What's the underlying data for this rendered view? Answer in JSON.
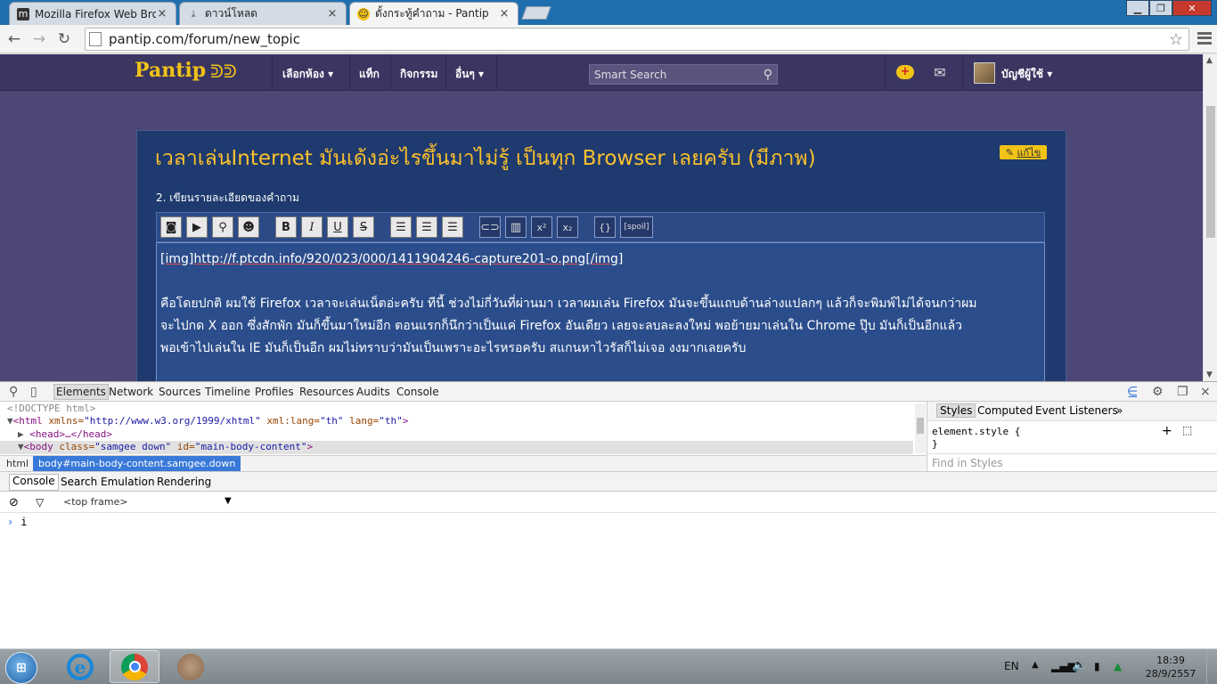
{
  "browser": {
    "tabs": [
      {
        "title": "Mozilla Firefox Web Brows",
        "active": false,
        "icon": "m-logo-icon"
      },
      {
        "title": "ดาวน์โหลด",
        "active": false,
        "icon": "download-icon"
      },
      {
        "title": "ตั้งกระทู้คำถาม - Pantip",
        "active": true,
        "icon": "pantip-smiley-icon"
      }
    ],
    "url": "pantip.com/forum/new_topic"
  },
  "site": {
    "logo": "Pantip",
    "nav": [
      "เลือกห้อง ▾",
      "แท็ก",
      "กิจกรรม",
      "อื่นๆ ▾"
    ],
    "search_placeholder": "Smart Search",
    "user": "บัญชีผู้ใช้ ▾"
  },
  "post": {
    "title": "เวลาเล่นInternet มันเด้งอ่ะไรขึ้นมาไม่รู้ เป็นทุก Browser เลยครับ (มีภาพ)",
    "edit_label": "แก้ไข",
    "section_label": "2. เขียนรายละเอียดของคำถาม",
    "body_lines": [
      "[img]http://f.ptcdn.info/920/023/000/1411904246-capture201-o.png[/img]",
      "",
      "คือโดยปกติ ผมใช้ Firefox เวลาจะเล่นเน็ตอ่ะครับ ทีนี้ ช่วงไม่กี่วันที่ผ่านมา เวลาผมเล่น Firefox มันจะขึ้นแถบด้านล่างแปลกๆ แล้วก็จะพิมพ์ไม่ได้จนกว่าผม",
      "จะไปกด X ออก ซึ่งสักพัก มันก็ขึ้นมาใหม่อีก ตอนแรกก็นึกว่าเป็นแค่ Firefox อันเดียว เลยจะลบละลงใหม่ พอย้ายมาเล่นใน Chrome ปุ๊บ มันก็เป็นอีกแล้ว",
      "พอเข้าไปเล่นใน IE มันก็เป็นอีก ผมไม่ทราบว่ามันเป็นเพราะอะไรหรอครับ สแกนหาไวรัสก็ไม่เจอ งงมากเลยครับ"
    ],
    "toolbar_buttons": [
      "camera-icon",
      "video-icon",
      "map-pin-icon",
      "emoji-icon",
      "B",
      "I",
      "U",
      "S",
      "align-left-icon",
      "align-center-icon",
      "align-right-icon",
      "link-icon",
      "table-icon",
      "x²",
      "x₂",
      "{}",
      "[spoil]"
    ]
  },
  "devtools": {
    "tabs": [
      "Elements",
      "Network",
      "Sources",
      "Timeline",
      "Profiles",
      "Resources",
      "Audits",
      "Console"
    ],
    "code": {
      "doctype": "<!DOCTYPE html>",
      "html_tag": "<html",
      "html_attr1": "xmlns=",
      "html_val1": "\"http://www.w3.org/1999/xhtml\"",
      "html_attr2": "xml:lang=",
      "html_val2": "\"th\"",
      "html_attr3": "lang=",
      "html_val3": "\"th\"",
      "head": "<head>…</head>",
      "body_tag": "<body",
      "body_attr1": "class=",
      "body_val1": "\"samgee down\"",
      "body_attr2": "id=",
      "body_val2": "\"main-body-content\""
    },
    "crumbs": [
      "html",
      "body#main-body-content.samgee.down"
    ],
    "style_tabs": [
      "Styles",
      "Computed",
      "Event Listeners",
      "»"
    ],
    "style_rule": "element.style {",
    "style_close": "}",
    "find_styles": "Find in Styles",
    "drawer_tabs": [
      "Console",
      "Search",
      "Emulation",
      "Rendering"
    ],
    "frame": "<top frame>",
    "console_input": "i"
  },
  "taskbar": {
    "lang": "EN",
    "time": "18:39",
    "date": "28/9/2557"
  }
}
